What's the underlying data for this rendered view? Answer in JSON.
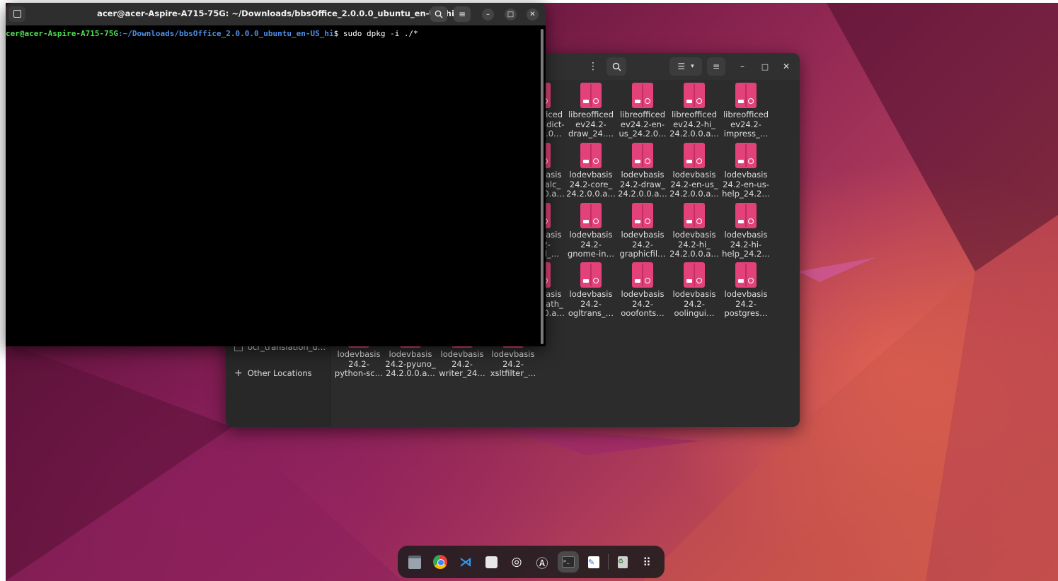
{
  "terminal": {
    "title": "acer@acer-Aspire-A715-75G: ~/Downloads/bbsOffice_2.0.0.0_ubuntu_en-US_hi",
    "prompt_user": "cer@acer-Aspire-A715-75G",
    "prompt_path": ":~/Downloads/bbsOffice_2.0.0.0_ubuntu_en-US_hi",
    "prompt_symbol": "$",
    "command": " sudo dpkg -i ./*"
  },
  "files": {
    "sidebar": {
      "partial_item": "ocr_translation_d…",
      "other_locations": "Other Locations"
    },
    "items": [
      [
        "libreofficed",
        "ev24.2-dict-",
        "n_24.2.0…"
      ],
      [
        "libreofficed",
        "ev24.2-",
        "draw_24…."
      ],
      [
        "libreofficed",
        "ev24.2-en-",
        "us_24.2.0…"
      ],
      [
        "libreofficed",
        "ev24.2-hi_",
        "24.2.0.0.a…"
      ],
      [
        "libreofficed",
        "ev24.2-",
        "impress_…"
      ],
      [
        "lodevbasis",
        "24.2-calc_",
        "24.2.0.0.a…"
      ],
      [
        "lodevbasis",
        "24.2-core_",
        "24.2.0.0.a…"
      ],
      [
        "lodevbasis",
        "24.2-draw_",
        "24.2.0.0.a…"
      ],
      [
        "lodevbasis",
        "24.2-en-us_",
        "24.2.0.0.a…"
      ],
      [
        "lodevbasis",
        "24.2-en-us-",
        "help_24.2…"
      ],
      [
        "lodevbasis",
        "24.2-",
        "irebird_…"
      ],
      [
        "lodevbasis",
        "24.2-",
        "gnome-in…"
      ],
      [
        "lodevbasis",
        "24.2-",
        "graphicfil…"
      ],
      [
        "lodevbasis",
        "24.2-hi_",
        "24.2.0.0.a…"
      ],
      [
        "lodevbasis",
        "24.2-hi-",
        "help_24.2…"
      ],
      [
        "lodevbasis",
        "24.2-math_",
        "24.2.0.0.a…"
      ],
      [
        "lodevbasis",
        "24.2-",
        "ogltrans_…"
      ],
      [
        "lodevbasis",
        "24.2-",
        "ooofonts…"
      ],
      [
        "lodevbasis",
        "24.2-",
        "oolingui…"
      ],
      [
        "lodevbasis",
        "24.2-",
        "postgres…"
      ],
      [
        "lodevbasis",
        "24.2-",
        "python-sc…"
      ],
      [
        "lodevbasis",
        "24.2-pyuno_",
        "24.2.0.0.a…"
      ],
      [
        "lodevbasis",
        "24.2-",
        "writer_24…"
      ],
      [
        "lodevbasis",
        "24.2-",
        "xsltfilter_…"
      ]
    ]
  },
  "icons": {
    "terminal_newtab": "tab-icon",
    "search": "search-icon",
    "menu": "hamburger-menu-icon",
    "minimize": "minimize-icon",
    "maximize": "maximize-icon",
    "close": "close-icon",
    "package": "debian-package-icon"
  },
  "dock": [
    "files",
    "chrome",
    "vscode",
    "settings",
    "disks",
    "software-center",
    "terminal",
    "text-editor",
    "trash",
    "app-grid"
  ],
  "colors": {
    "prompt_user": "#4ee14e",
    "prompt_path": "#4d8fe8",
    "package_icon": "#e3417a",
    "accent": "#e95420"
  }
}
